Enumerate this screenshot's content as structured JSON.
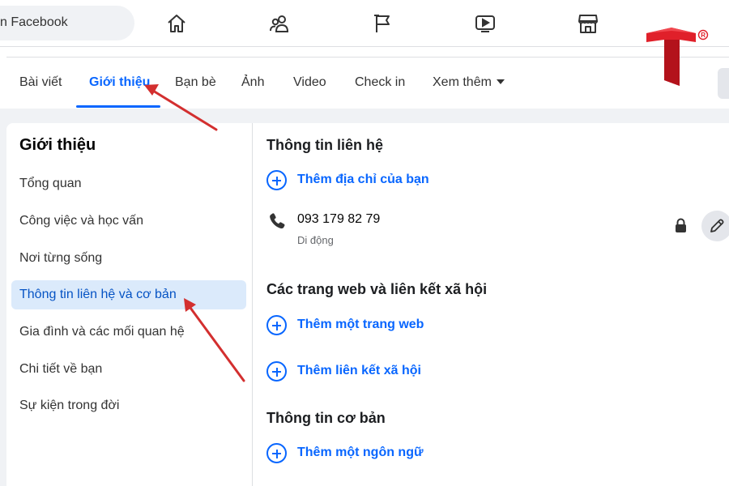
{
  "search": {
    "text": "n Facebook"
  },
  "nav_icons": [
    "home-icon",
    "friends-icon",
    "pages-flag-icon",
    "watch-video-icon",
    "marketplace-icon"
  ],
  "tabs": [
    {
      "label": "Bài viết"
    },
    {
      "label": "Giới thiệu",
      "active": true
    },
    {
      "label": "Bạn bè"
    },
    {
      "label": "Ảnh"
    },
    {
      "label": "Video"
    },
    {
      "label": "Check in"
    },
    {
      "label": "Xem thêm"
    }
  ],
  "about": {
    "heading": "Giới thiệu",
    "menu": [
      {
        "label": "Tổng quan"
      },
      {
        "label": "Công việc và học vấn"
      },
      {
        "label": "Nơi từng sống"
      },
      {
        "label": "Thông tin liên hệ và cơ bản",
        "active": true
      },
      {
        "label": "Gia đình và các mối quan hệ"
      },
      {
        "label": "Chi tiết về bạn"
      },
      {
        "label": "Sự kiện trong đời"
      }
    ]
  },
  "contact": {
    "title": "Thông tin liên hệ",
    "add_address": "Thêm địa chỉ của bạn",
    "phone_number": "093 179 82 79",
    "phone_type": "Di động"
  },
  "websites": {
    "title": "Các trang web và liên kết xã hội",
    "add_website": "Thêm một trang web",
    "add_social": "Thêm liên kết xã hội"
  },
  "basic": {
    "title": "Thông tin cơ bản",
    "add_language": "Thêm một ngôn ngữ"
  },
  "colors": {
    "accent": "#0866ff",
    "active_bg": "#dbeafb",
    "annotation": "#d32f2f",
    "logo_red": "#e0202a"
  }
}
